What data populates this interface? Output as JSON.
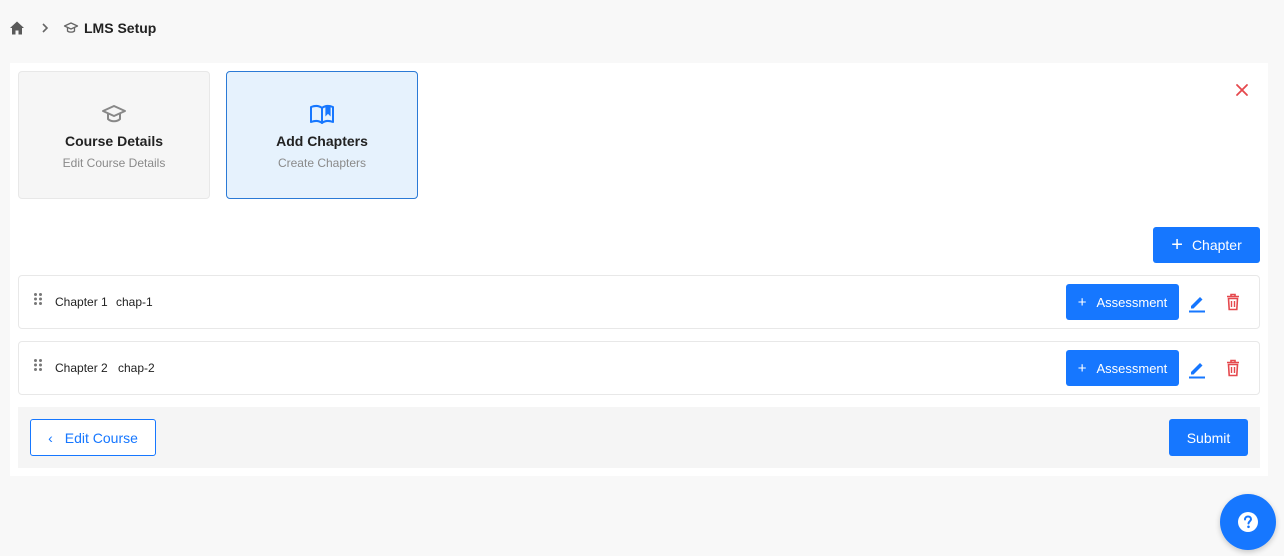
{
  "breadcrumb": {
    "label": "LMS Setup"
  },
  "steps": [
    {
      "title": "Course Details",
      "subtitle": "Edit Course Details"
    },
    {
      "title": "Add Chapters",
      "subtitle": "Create Chapters"
    }
  ],
  "actions": {
    "add_chapter": "Chapter",
    "assessment": "Assessment"
  },
  "chapters": [
    {
      "name": "Chapter 1",
      "code": "chap-1"
    },
    {
      "name": "Chapter 2",
      "code": "chap-2"
    }
  ],
  "footer": {
    "back": "Edit Course",
    "submit": "Submit"
  },
  "colors": {
    "primary": "#1677ff",
    "danger": "#e5484d",
    "active_bg": "#e6f2fd"
  },
  "icons": [
    "home-icon",
    "chevron-right-icon",
    "graduation-cap-icon",
    "book-open-icon",
    "close-icon",
    "drag-handle-icon",
    "edit-icon",
    "trash-icon",
    "help-icon"
  ]
}
